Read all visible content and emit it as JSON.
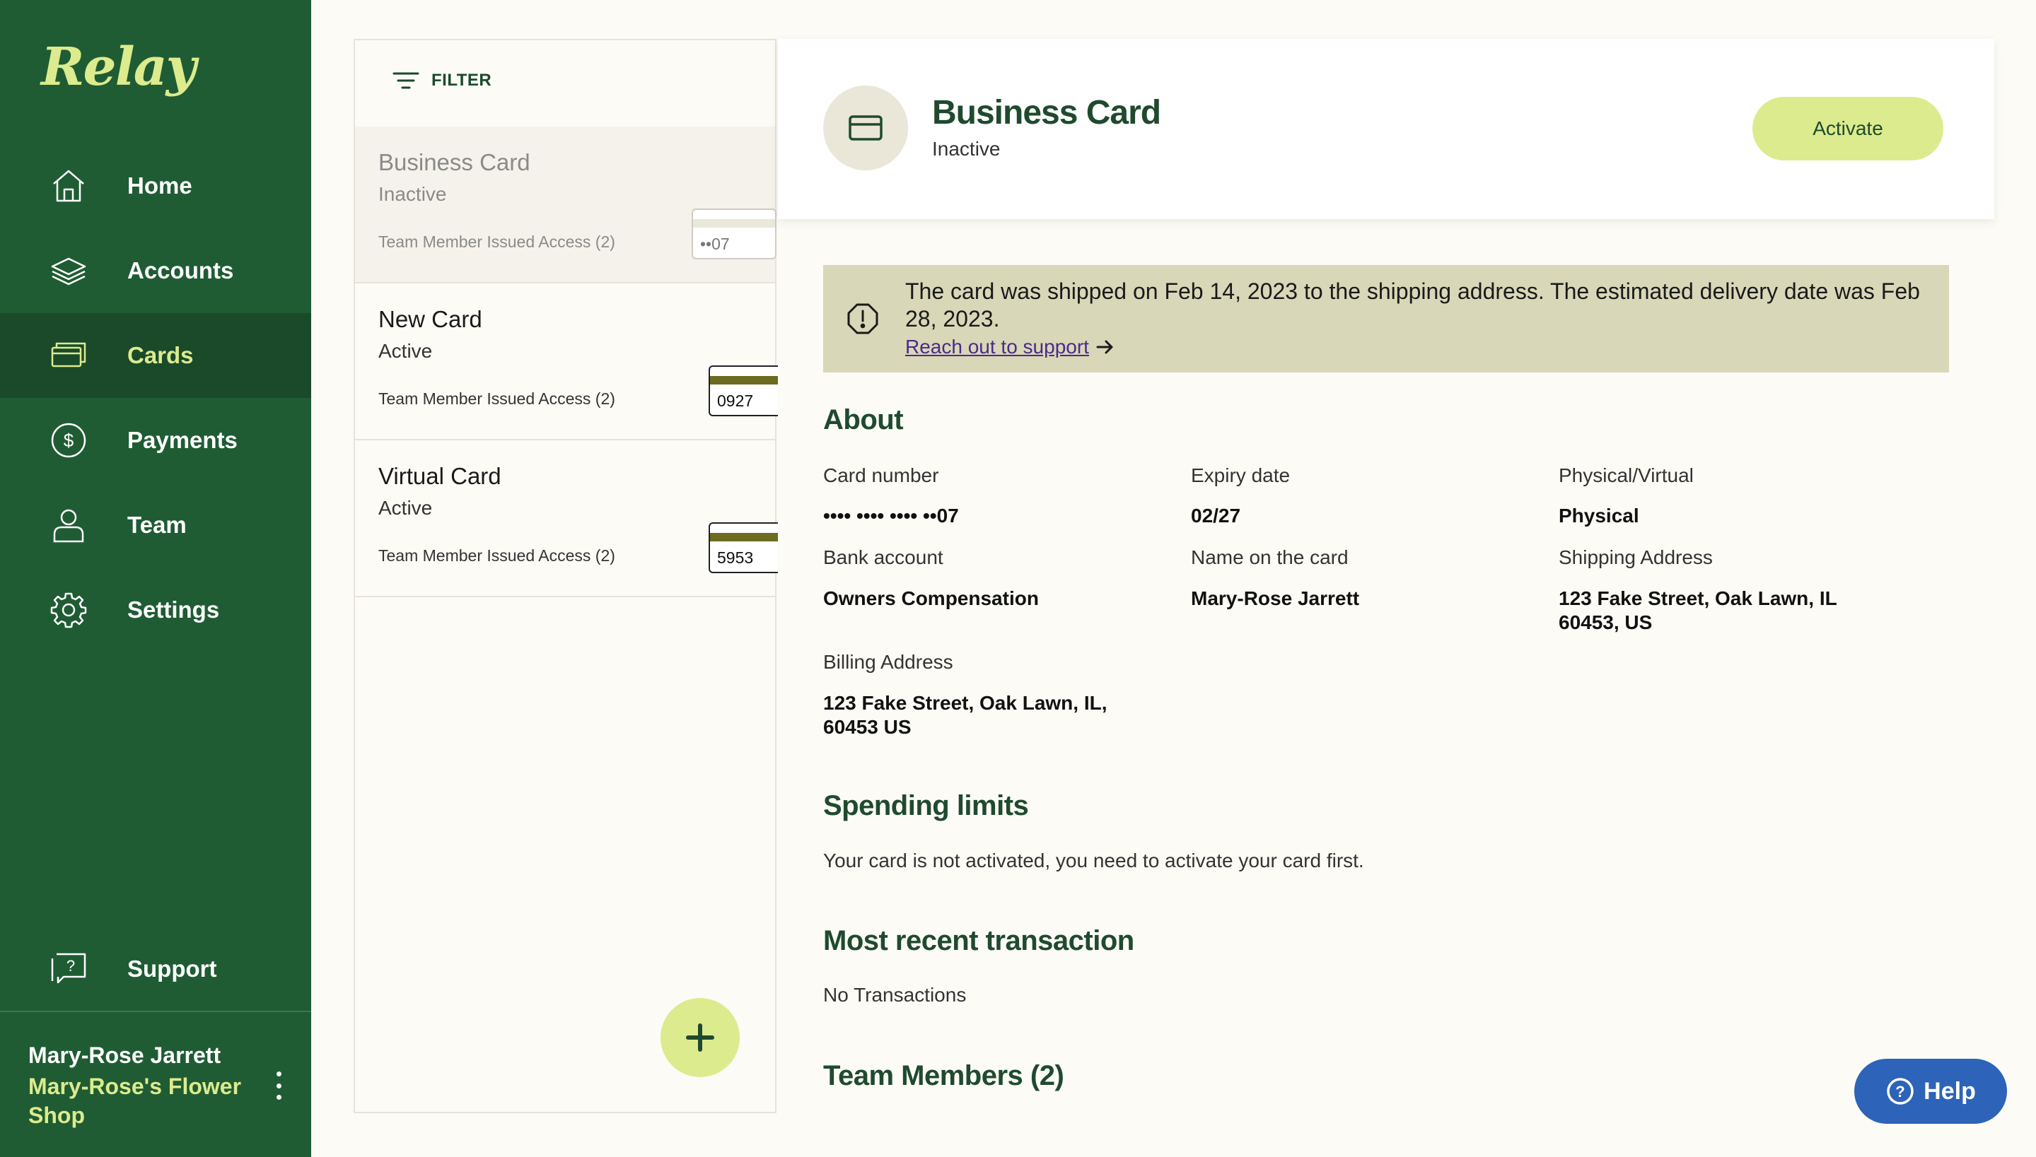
{
  "app": {
    "logo": "Relay"
  },
  "sidebar": {
    "items": [
      {
        "label": "Home",
        "icon": "home-icon"
      },
      {
        "label": "Accounts",
        "icon": "layers-icon"
      },
      {
        "label": "Cards",
        "icon": "card-icon",
        "active": true
      },
      {
        "label": "Payments",
        "icon": "dollar-icon"
      },
      {
        "label": "Team",
        "icon": "person-icon"
      },
      {
        "label": "Settings",
        "icon": "gear-icon"
      }
    ],
    "support": {
      "label": "Support",
      "icon": "support-icon"
    },
    "user": {
      "name": "Mary-Rose Jarrett",
      "company": "Mary-Rose's Flower Shop"
    }
  },
  "card_list": {
    "filter_label": "FILTER",
    "items": [
      {
        "name": "Business Card",
        "status": "Inactive",
        "access": "Team Member Issued Access (2)",
        "last4": "••07",
        "selected": true
      },
      {
        "name": "New Card",
        "status": "Active",
        "access": "Team Member Issued Access (2)",
        "last4": "0927"
      },
      {
        "name": "Virtual Card",
        "status": "Active",
        "access": "Team Member Issued Access (2)",
        "last4": "5953"
      }
    ]
  },
  "detail": {
    "title": "Business Card",
    "status": "Inactive",
    "activate_label": "Activate",
    "notice": {
      "text": "The card was shipped on Feb 14, 2023 to the shipping address. The estimated delivery date was Feb 28, 2023.",
      "link": "Reach out to support"
    },
    "about": {
      "heading": "About",
      "card_number_label": "Card number",
      "card_number": "•••• •••• •••• ••07",
      "expiry_label": "Expiry date",
      "expiry": "02/27",
      "type_label": "Physical/Virtual",
      "type": "Physical",
      "bank_account_label": "Bank account",
      "bank_account": "Owners Compensation",
      "name_label": "Name on the card",
      "name": "Mary-Rose Jarrett",
      "shipping_label": "Shipping Address",
      "shipping_line1": "123 Fake Street, Oak Lawn, IL",
      "shipping_line2": "60453, US",
      "billing_label": "Billing Address",
      "billing_line1": "123 Fake Street, Oak Lawn, IL,",
      "billing_line2": "60453 US"
    },
    "spending": {
      "heading": "Spending limits",
      "text": "Your card is not activated, you need to activate your card first."
    },
    "transactions": {
      "heading": "Most recent transaction",
      "text": "No Transactions"
    },
    "team": {
      "heading": "Team Members (2)"
    }
  },
  "help": {
    "label": "Help"
  },
  "colors": {
    "sidebar": "#1F5C33",
    "accent": "#DCEB8E",
    "notice": "#D8D7B8",
    "help": "#2D63B8"
  }
}
